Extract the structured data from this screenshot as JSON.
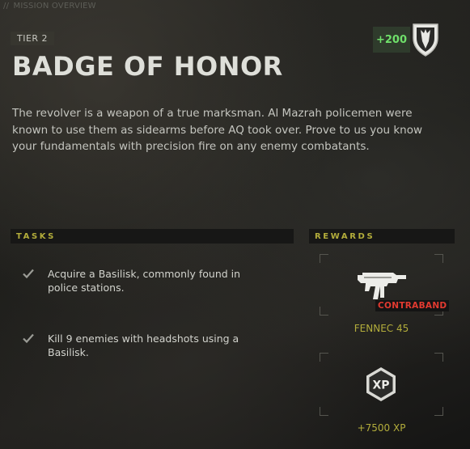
{
  "breadcrumb": {
    "slashes": "//",
    "label": "MISSION OVERVIEW"
  },
  "mission": {
    "tier": "TIER 2",
    "title": "BADGE OF HONOR",
    "xp_bonus": "+200",
    "description": "The revolver is a weapon of a true marksman. Al Mazrah policemen were known to use them as sidearms before AQ took over. Prove to us you know your fundamentals with precision fire on any enemy combatants."
  },
  "tasks": {
    "header": "TASKS",
    "items": [
      {
        "text": "Acquire a Basilisk, commonly found in police stations.",
        "completed": true,
        "icon": "checkmark-icon"
      },
      {
        "text": "Kill 9 enemies with headshots using a Basilisk.",
        "completed": true,
        "icon": "checkmark-icon"
      }
    ]
  },
  "rewards": {
    "header": "REWARDS",
    "items": [
      {
        "name": "FENNEC 45",
        "tag": "CONTRABAND",
        "icon": "smg-weapon-icon"
      },
      {
        "name": "+7500 XP",
        "icon": "xp-hexagon-icon"
      }
    ]
  },
  "colors": {
    "accent_yellow": "#b3ad3b",
    "xp_green": "#6fe06a",
    "contraband_red": "#e23a30",
    "title_white": "#dedfd9"
  }
}
